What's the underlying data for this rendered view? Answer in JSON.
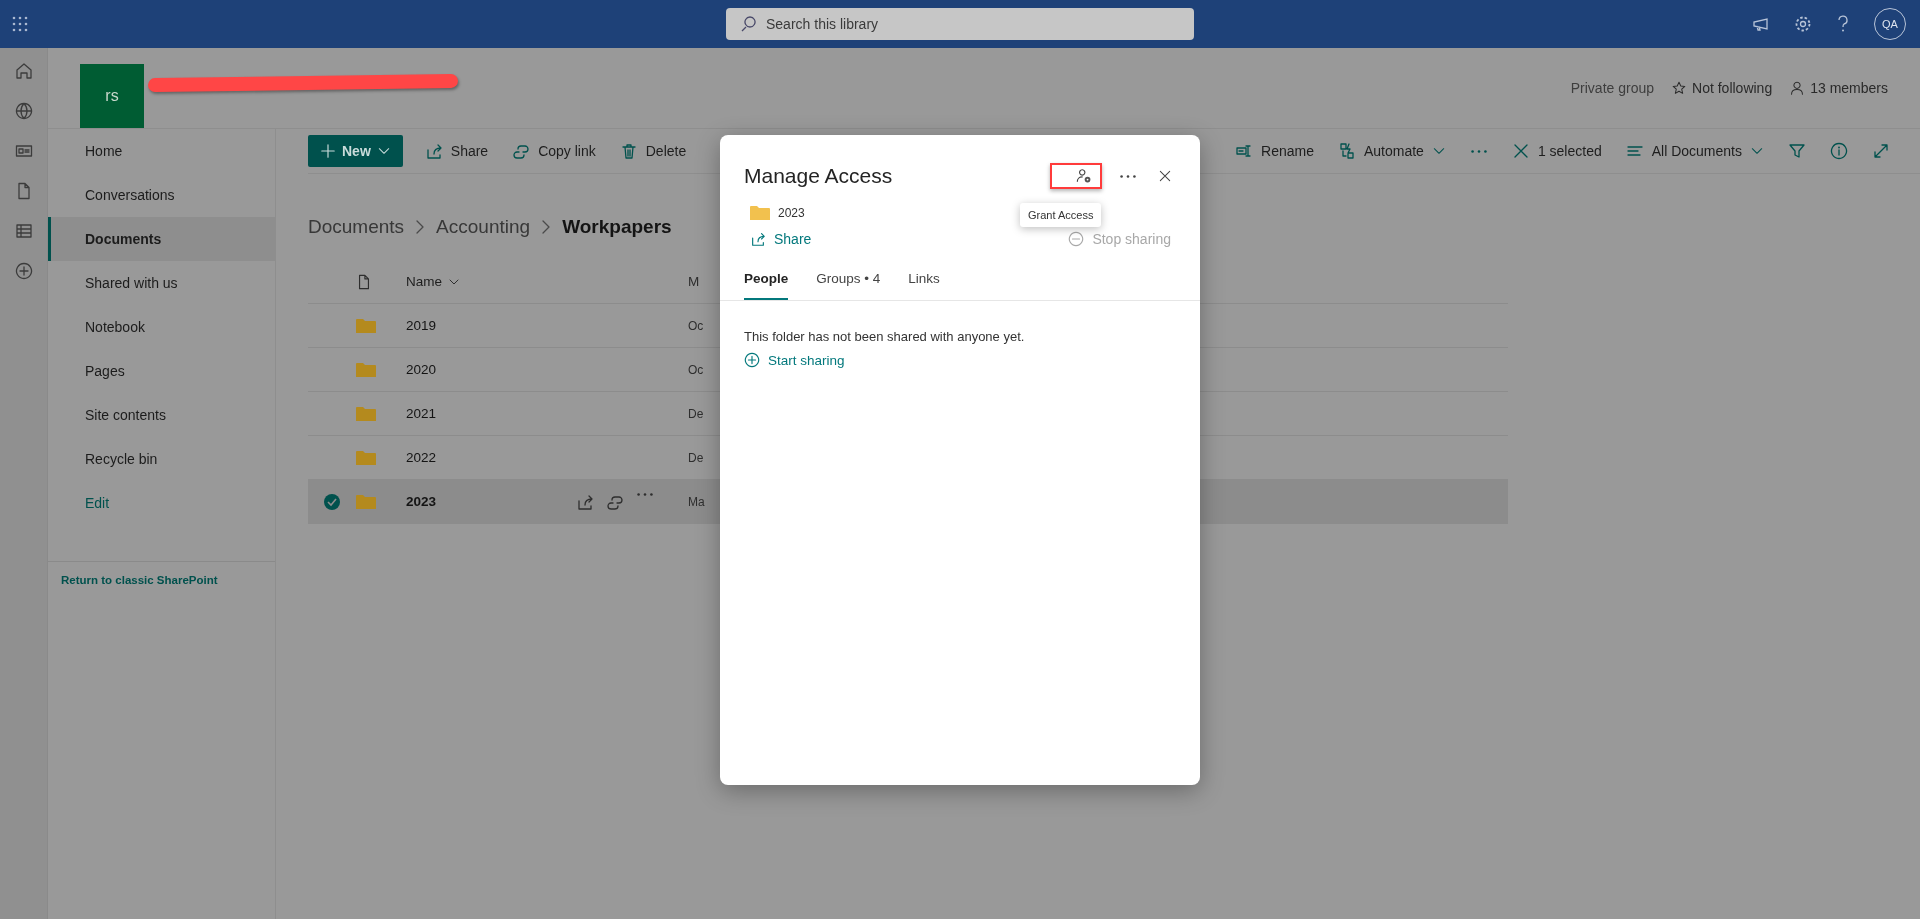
{
  "top_bar": {
    "search": {
      "placeholder": "Search this library"
    },
    "avatar": "QA"
  },
  "site": {
    "logo": "rs",
    "privacy": "Private group",
    "follow": "Not following",
    "members": "13 members"
  },
  "nav": {
    "items": [
      {
        "label": "Home",
        "selected": false
      },
      {
        "label": "Conversations",
        "selected": false
      },
      {
        "label": "Documents",
        "selected": true
      },
      {
        "label": "Shared with us",
        "selected": false
      },
      {
        "label": "Notebook",
        "selected": false
      },
      {
        "label": "Pages",
        "selected": false
      },
      {
        "label": "Site contents",
        "selected": false
      },
      {
        "label": "Recycle bin",
        "selected": false
      }
    ],
    "edit": "Edit",
    "classic_link": "Return to classic SharePoint"
  },
  "toolbar": {
    "new": "New",
    "left": [
      {
        "kind": "share",
        "label": "Share"
      },
      {
        "kind": "link",
        "label": "Copy link"
      },
      {
        "kind": "delete",
        "label": "Delete"
      }
    ],
    "right": [
      {
        "kind": "rename",
        "label": "Rename"
      },
      {
        "kind": "automate",
        "label": "Automate"
      },
      {
        "kind": "more"
      },
      {
        "kind": "clear",
        "label": "1 selected"
      },
      {
        "kind": "view",
        "label": "All Documents"
      },
      {
        "kind": "filter"
      },
      {
        "kind": "info"
      },
      {
        "kind": "expand"
      }
    ]
  },
  "breadcrumb": [
    "Documents",
    "Accounting",
    "Workpapers"
  ],
  "table": {
    "columns": [
      "Name",
      "M"
    ],
    "rows": [
      {
        "name": "2019",
        "column_2": "Oc",
        "selected": false
      },
      {
        "name": "2020",
        "column_2": "Oc",
        "selected": false
      },
      {
        "name": "2021",
        "column_2": "De",
        "selected": false
      },
      {
        "name": "2022",
        "column_2": "De",
        "selected": false
      },
      {
        "name": "2023",
        "column_2": "Ma",
        "selected": true
      }
    ]
  },
  "dialog": {
    "title": "Manage Access",
    "item": "2023",
    "share": "Share",
    "stop_sharing": {
      "label": "Stop sharing",
      "disabled": true
    },
    "tooltip": "Grant Access",
    "tabs": [
      {
        "label": "People",
        "selected": true
      },
      {
        "label": "Groups • 4",
        "selected": false
      },
      {
        "label": "Links",
        "selected": false
      }
    ],
    "message": "This folder has not been shared with anyone yet.",
    "start_sharing": "Start sharing"
  }
}
